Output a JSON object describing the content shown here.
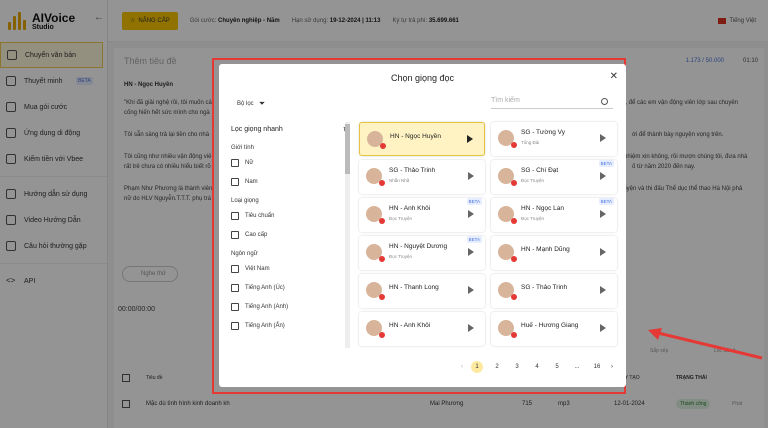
{
  "app": {
    "name": "AIVoice",
    "subtitle": "Studio"
  },
  "topbar": {
    "upgrade_label": "NÂNG CẤP",
    "plan_label": "Gói cước:",
    "plan_value": "Chuyên nghiệp - Năm",
    "expiry_label": "Hạn sử dụng:",
    "expiry_value": "19-12-2024 | 11:13",
    "chars_label": "Ký tự trả phí:",
    "chars_value": "35.699.661",
    "language": "Tiếng Việt"
  },
  "sidebar": {
    "items": [
      {
        "label": "Chuyển văn bản"
      },
      {
        "label": "Thuyết minh",
        "badge": "BETA"
      },
      {
        "label": "Mua gói cước"
      },
      {
        "label": "Ứng dụng di động"
      },
      {
        "label": "Kiếm tiền với Vbee"
      },
      {
        "label": "Hướng dẫn sử dụng"
      },
      {
        "label": "Video Hướng Dẫn"
      },
      {
        "label": "Câu hỏi thường gặp"
      },
      {
        "label": "API"
      }
    ]
  },
  "editor": {
    "title_placeholder": "Thêm tiêu đề",
    "char_count": "1.173 / 50.000",
    "duration": "01:10",
    "voice_chip": "HN - Ngọc Huyền",
    "para1": "\"Khi đã giải nghệ rồi, tôi muốn cả",
    "para1_end": "ít, để các em vận động viên lớp sau chuyên",
    "para2": "cống hiến hết sức mình cho ngà",
    "para3": "Tôi sẵn sàng trả lại tiền cho nhà",
    "para3_end": "ới để thành bày nguyện vọng trên.",
    "para4": "Tôi cũng như nhiều vận động viê",
    "para4_end": "nhiệm xin không, rồi mượn chúng tôi, đưa nhà",
    "para5": "rất trẻ chưa có nhiều hiểu biết rõ",
    "para5_end": "ố từ năm 2020 đến nay.",
    "para6": "Phạm Như Phương là thành viên",
    "para6_end": "luyện và thi đấu Thể dục thể thao Hà Nội phả",
    "para7": "nữ do HLV Nguyễn.T.T.T. phụ trá",
    "listen_label": "Nghe thử",
    "time": "00:00/00:00"
  },
  "table": {
    "col_title": "Tiêu đề",
    "col_status": "TRẠNG THÁI",
    "col_date": "NGÀY TẠO",
    "row_title": "Mặc dù tình hình kinh doanh kh",
    "row_voice": "Mai Phương",
    "row_chars": "715",
    "row_format": "mp3",
    "row_date": "12-01-2024",
    "row_status": "Thành công",
    "row_play": "Phát",
    "select_hint": "Sắp xếp",
    "filter_hint": "Lọc tất cả"
  },
  "modal": {
    "title": "Chọn giọng đọc",
    "filter_label": "Bộ lọc",
    "search_placeholder": "Tìm kiếm",
    "quick_filter": "Lọc giọng nhanh",
    "groups": [
      {
        "label": "Giới tính",
        "options": [
          "Nữ",
          "Nam"
        ]
      },
      {
        "label": "Loại giọng",
        "options": [
          "Tiêu chuẩn",
          "Cao cấp"
        ]
      },
      {
        "label": "Ngôn ngữ",
        "options": [
          "Việt Nam",
          "Tiếng Anh (Úc)",
          "Tiếng Anh (Anh)",
          "Tiếng Anh (Ấn)"
        ]
      }
    ],
    "voices": [
      {
        "name": "HN - Ngọc Huyền",
        "sub": "",
        "beta": "",
        "selected": true
      },
      {
        "name": "SG - Tường Vy",
        "sub": "Tổng Đài",
        "beta": ""
      },
      {
        "name": "SG - Thảo Trinh",
        "sub": "Nhẫn Nhã",
        "beta": ""
      },
      {
        "name": "SG - Chí Đạt",
        "sub": "Đọc Truyện",
        "beta": "BETA"
      },
      {
        "name": "HN - Anh Khôi",
        "sub": "Đọc Truyện",
        "beta": "BETA"
      },
      {
        "name": "HN - Ngọc Lan",
        "sub": "Đọc Truyện",
        "beta": "BETA"
      },
      {
        "name": "HN - Nguyệt Dương",
        "sub": "Đọc Truyện",
        "beta": "BETA"
      },
      {
        "name": "HN - Mạnh Dũng",
        "sub": "",
        "beta": ""
      },
      {
        "name": "HN - Thanh Long",
        "sub": "",
        "beta": ""
      },
      {
        "name": "SG - Thảo Trinh",
        "sub": "",
        "beta": ""
      },
      {
        "name": "HN - Anh Khôi",
        "sub": "",
        "beta": ""
      },
      {
        "name": "Huế - Hương Giang",
        "sub": "",
        "beta": ""
      }
    ],
    "pagination": {
      "prev": "‹",
      "pages": [
        "1",
        "2",
        "3",
        "4",
        "5",
        "...",
        "16"
      ],
      "next": "›",
      "current": "1"
    }
  },
  "colors": {
    "accent": "#f6c500",
    "highlight": "#e53935",
    "link": "#4a74d9"
  }
}
